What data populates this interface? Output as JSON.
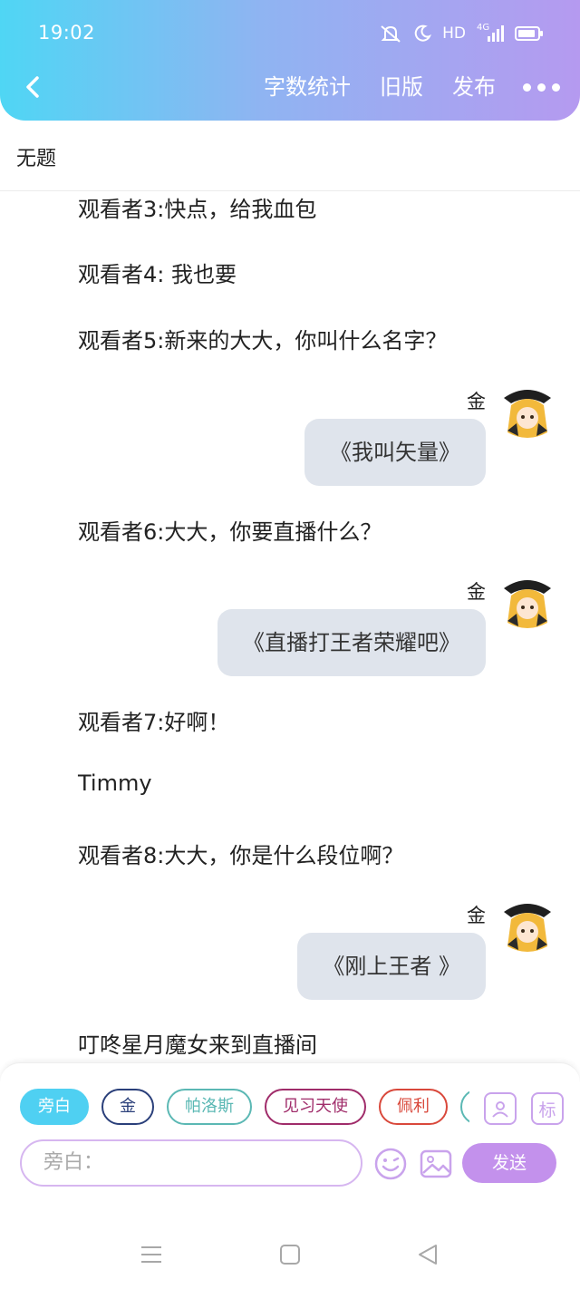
{
  "status": {
    "time": "19:02",
    "network_label": "HD",
    "signal_label": "4G"
  },
  "nav": {
    "word_count": "字数统计",
    "old_version": "旧版",
    "publish": "发布"
  },
  "doc": {
    "title": "无题"
  },
  "chat": {
    "narration_1": "观看者3:快点，给我血包",
    "narration_2": "观看者4: 我也要",
    "narration_3": "观看者5:新来的大大，你叫什么名字？",
    "msg_1": {
      "name": "金",
      "text": "《我叫矢量》"
    },
    "narration_4": "观看者6:大大，你要直播什么？",
    "msg_2": {
      "name": "金",
      "text": "《直播打王者荣耀吧》"
    },
    "narration_5": "观看者7:好啊！",
    "narration_6": "Timmy",
    "narration_7": "观看者8:大大，你是什么段位啊？",
    "msg_3": {
      "name": "金",
      "text": "《刚上王者 》"
    },
    "narration_8": "叮咚星月魔女来到直播间"
  },
  "roles": [
    {
      "label": "旁白",
      "color": "#4fd0f2",
      "selected": true
    },
    {
      "label": "金",
      "color": "#2a3f7a"
    },
    {
      "label": "帕洛斯",
      "color": "#5bb8b4"
    },
    {
      "label": "见习天使",
      "color": "#a02c6a"
    },
    {
      "label": "佩利",
      "color": "#d9483b"
    }
  ],
  "tools": {
    "tag_label": "标"
  },
  "input": {
    "placeholder": "旁白："
  },
  "send": {
    "label": "发送"
  },
  "colors": {
    "accent": "#c391ec",
    "bubble": "#dfe4ec"
  }
}
